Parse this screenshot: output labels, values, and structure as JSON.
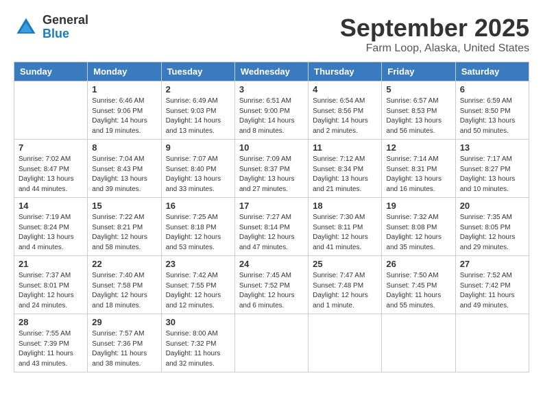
{
  "header": {
    "logo_line1": "General",
    "logo_line2": "Blue",
    "month": "September 2025",
    "location": "Farm Loop, Alaska, United States"
  },
  "days_of_week": [
    "Sunday",
    "Monday",
    "Tuesday",
    "Wednesday",
    "Thursday",
    "Friday",
    "Saturday"
  ],
  "weeks": [
    [
      {
        "day": "",
        "sunrise": "",
        "sunset": "",
        "daylight": ""
      },
      {
        "day": "1",
        "sunrise": "Sunrise: 6:46 AM",
        "sunset": "Sunset: 9:06 PM",
        "daylight": "Daylight: 14 hours and 19 minutes."
      },
      {
        "day": "2",
        "sunrise": "Sunrise: 6:49 AM",
        "sunset": "Sunset: 9:03 PM",
        "daylight": "Daylight: 14 hours and 13 minutes."
      },
      {
        "day": "3",
        "sunrise": "Sunrise: 6:51 AM",
        "sunset": "Sunset: 9:00 PM",
        "daylight": "Daylight: 14 hours and 8 minutes."
      },
      {
        "day": "4",
        "sunrise": "Sunrise: 6:54 AM",
        "sunset": "Sunset: 8:56 PM",
        "daylight": "Daylight: 14 hours and 2 minutes."
      },
      {
        "day": "5",
        "sunrise": "Sunrise: 6:57 AM",
        "sunset": "Sunset: 8:53 PM",
        "daylight": "Daylight: 13 hours and 56 minutes."
      },
      {
        "day": "6",
        "sunrise": "Sunrise: 6:59 AM",
        "sunset": "Sunset: 8:50 PM",
        "daylight": "Daylight: 13 hours and 50 minutes."
      }
    ],
    [
      {
        "day": "7",
        "sunrise": "Sunrise: 7:02 AM",
        "sunset": "Sunset: 8:47 PM",
        "daylight": "Daylight: 13 hours and 44 minutes."
      },
      {
        "day": "8",
        "sunrise": "Sunrise: 7:04 AM",
        "sunset": "Sunset: 8:43 PM",
        "daylight": "Daylight: 13 hours and 39 minutes."
      },
      {
        "day": "9",
        "sunrise": "Sunrise: 7:07 AM",
        "sunset": "Sunset: 8:40 PM",
        "daylight": "Daylight: 13 hours and 33 minutes."
      },
      {
        "day": "10",
        "sunrise": "Sunrise: 7:09 AM",
        "sunset": "Sunset: 8:37 PM",
        "daylight": "Daylight: 13 hours and 27 minutes."
      },
      {
        "day": "11",
        "sunrise": "Sunrise: 7:12 AM",
        "sunset": "Sunset: 8:34 PM",
        "daylight": "Daylight: 13 hours and 21 minutes."
      },
      {
        "day": "12",
        "sunrise": "Sunrise: 7:14 AM",
        "sunset": "Sunset: 8:31 PM",
        "daylight": "Daylight: 13 hours and 16 minutes."
      },
      {
        "day": "13",
        "sunrise": "Sunrise: 7:17 AM",
        "sunset": "Sunset: 8:27 PM",
        "daylight": "Daylight: 13 hours and 10 minutes."
      }
    ],
    [
      {
        "day": "14",
        "sunrise": "Sunrise: 7:19 AM",
        "sunset": "Sunset: 8:24 PM",
        "daylight": "Daylight: 13 hours and 4 minutes."
      },
      {
        "day": "15",
        "sunrise": "Sunrise: 7:22 AM",
        "sunset": "Sunset: 8:21 PM",
        "daylight": "Daylight: 12 hours and 58 minutes."
      },
      {
        "day": "16",
        "sunrise": "Sunrise: 7:25 AM",
        "sunset": "Sunset: 8:18 PM",
        "daylight": "Daylight: 12 hours and 53 minutes."
      },
      {
        "day": "17",
        "sunrise": "Sunrise: 7:27 AM",
        "sunset": "Sunset: 8:14 PM",
        "daylight": "Daylight: 12 hours and 47 minutes."
      },
      {
        "day": "18",
        "sunrise": "Sunrise: 7:30 AM",
        "sunset": "Sunset: 8:11 PM",
        "daylight": "Daylight: 12 hours and 41 minutes."
      },
      {
        "day": "19",
        "sunrise": "Sunrise: 7:32 AM",
        "sunset": "Sunset: 8:08 PM",
        "daylight": "Daylight: 12 hours and 35 minutes."
      },
      {
        "day": "20",
        "sunrise": "Sunrise: 7:35 AM",
        "sunset": "Sunset: 8:05 PM",
        "daylight": "Daylight: 12 hours and 29 minutes."
      }
    ],
    [
      {
        "day": "21",
        "sunrise": "Sunrise: 7:37 AM",
        "sunset": "Sunset: 8:01 PM",
        "daylight": "Daylight: 12 hours and 24 minutes."
      },
      {
        "day": "22",
        "sunrise": "Sunrise: 7:40 AM",
        "sunset": "Sunset: 7:58 PM",
        "daylight": "Daylight: 12 hours and 18 minutes."
      },
      {
        "day": "23",
        "sunrise": "Sunrise: 7:42 AM",
        "sunset": "Sunset: 7:55 PM",
        "daylight": "Daylight: 12 hours and 12 minutes."
      },
      {
        "day": "24",
        "sunrise": "Sunrise: 7:45 AM",
        "sunset": "Sunset: 7:52 PM",
        "daylight": "Daylight: 12 hours and 6 minutes."
      },
      {
        "day": "25",
        "sunrise": "Sunrise: 7:47 AM",
        "sunset": "Sunset: 7:48 PM",
        "daylight": "Daylight: 12 hours and 1 minute."
      },
      {
        "day": "26",
        "sunrise": "Sunrise: 7:50 AM",
        "sunset": "Sunset: 7:45 PM",
        "daylight": "Daylight: 11 hours and 55 minutes."
      },
      {
        "day": "27",
        "sunrise": "Sunrise: 7:52 AM",
        "sunset": "Sunset: 7:42 PM",
        "daylight": "Daylight: 11 hours and 49 minutes."
      }
    ],
    [
      {
        "day": "28",
        "sunrise": "Sunrise: 7:55 AM",
        "sunset": "Sunset: 7:39 PM",
        "daylight": "Daylight: 11 hours and 43 minutes."
      },
      {
        "day": "29",
        "sunrise": "Sunrise: 7:57 AM",
        "sunset": "Sunset: 7:36 PM",
        "daylight": "Daylight: 11 hours and 38 minutes."
      },
      {
        "day": "30",
        "sunrise": "Sunrise: 8:00 AM",
        "sunset": "Sunset: 7:32 PM",
        "daylight": "Daylight: 11 hours and 32 minutes."
      },
      {
        "day": "",
        "sunrise": "",
        "sunset": "",
        "daylight": ""
      },
      {
        "day": "",
        "sunrise": "",
        "sunset": "",
        "daylight": ""
      },
      {
        "day": "",
        "sunrise": "",
        "sunset": "",
        "daylight": ""
      },
      {
        "day": "",
        "sunrise": "",
        "sunset": "",
        "daylight": ""
      }
    ]
  ]
}
